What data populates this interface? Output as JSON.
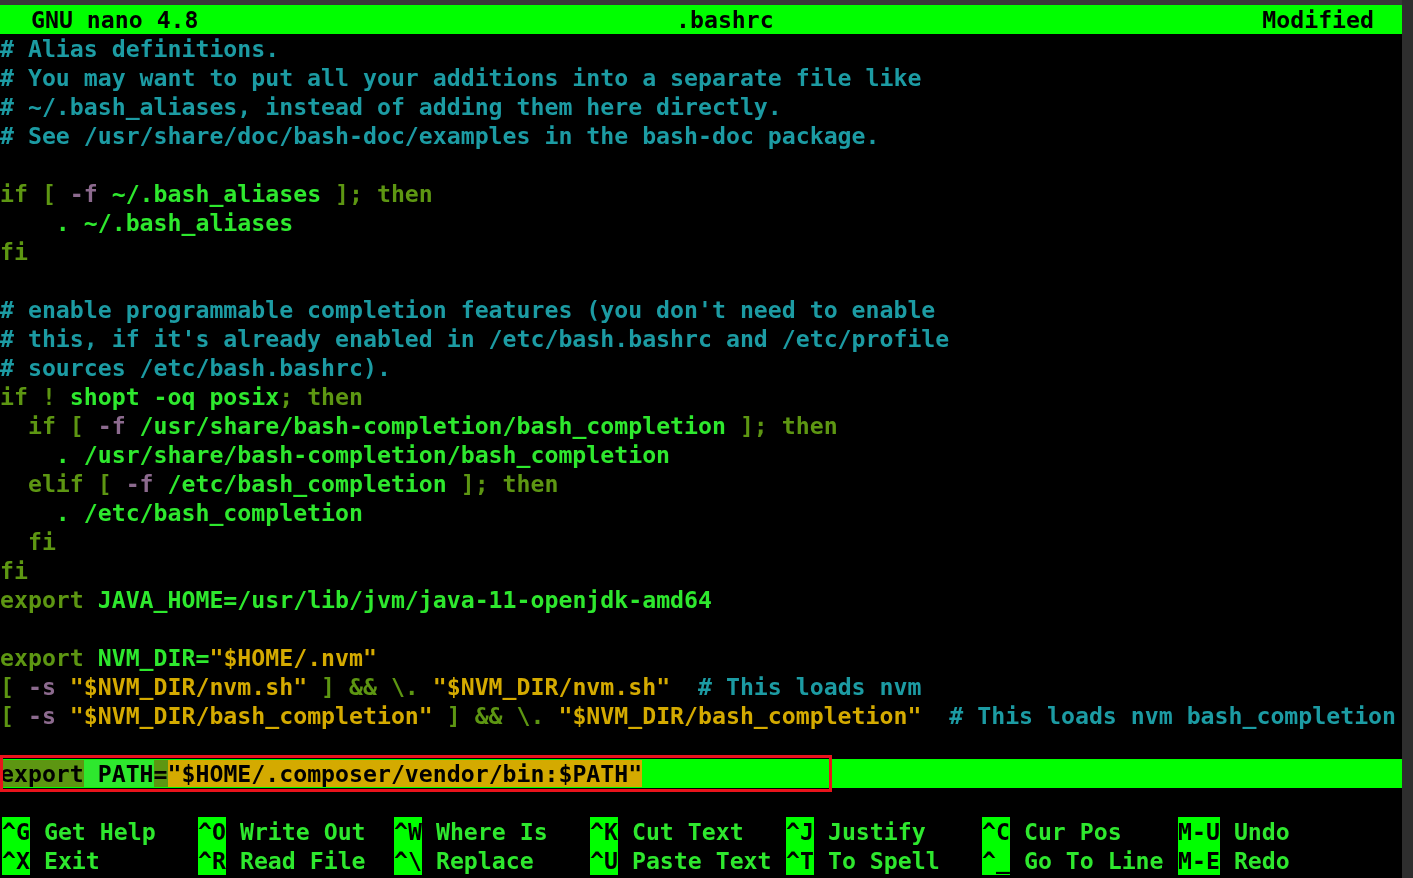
{
  "title_bar": {
    "app": "GNU nano 4.8",
    "file": ".bashrc",
    "status": "Modified"
  },
  "lines": [
    {
      "kind": "code",
      "segments": [
        {
          "kind": "comment",
          "text": "# Alias definitions."
        }
      ]
    },
    {
      "kind": "code",
      "segments": [
        {
          "kind": "comment",
          "text": "# You may want to put all your additions into a separate file like"
        }
      ]
    },
    {
      "kind": "code",
      "segments": [
        {
          "kind": "comment",
          "text": "# ~/.bash_aliases, instead of adding them here directly."
        }
      ]
    },
    {
      "kind": "code",
      "segments": [
        {
          "kind": "comment",
          "text": "# See /usr/share/doc/bash-doc/examples in the bash-doc package."
        }
      ]
    },
    {
      "kind": "blank"
    },
    {
      "kind": "code",
      "segments": [
        {
          "kind": "keyword",
          "text": "if [ "
        },
        {
          "kind": "option",
          "text": "-f"
        },
        {
          "kind": "word",
          "text": " ~/.bash_aliases"
        },
        {
          "kind": "keyword",
          "text": " ]; then"
        }
      ]
    },
    {
      "kind": "code",
      "segments": [
        {
          "kind": "word",
          "text": "    . ~/.bash_aliases"
        }
      ]
    },
    {
      "kind": "code",
      "segments": [
        {
          "kind": "keyword",
          "text": "fi"
        }
      ]
    },
    {
      "kind": "blank"
    },
    {
      "kind": "code",
      "segments": [
        {
          "kind": "comment",
          "text": "# enable programmable completion features (you don't need to enable"
        }
      ]
    },
    {
      "kind": "code",
      "segments": [
        {
          "kind": "comment",
          "text": "# this, if it's already enabled in /etc/bash.bashrc and /etc/profile"
        }
      ]
    },
    {
      "kind": "code",
      "segments": [
        {
          "kind": "comment",
          "text": "# sources /etc/bash.bashrc)."
        }
      ]
    },
    {
      "kind": "code",
      "segments": [
        {
          "kind": "keyword",
          "text": "if ! "
        },
        {
          "kind": "word",
          "text": "shopt -oq posix"
        },
        {
          "kind": "keyword",
          "text": "; then"
        }
      ]
    },
    {
      "kind": "code",
      "segments": [
        {
          "kind": "keyword",
          "text": "  if [ "
        },
        {
          "kind": "option",
          "text": "-f"
        },
        {
          "kind": "word",
          "text": " /usr/share/bash-completion/bash_completion"
        },
        {
          "kind": "keyword",
          "text": " ]; then"
        }
      ]
    },
    {
      "kind": "code",
      "segments": [
        {
          "kind": "word",
          "text": "    . /usr/share/bash-completion/bash_completion"
        }
      ]
    },
    {
      "kind": "code",
      "segments": [
        {
          "kind": "keyword",
          "text": "  elif [ "
        },
        {
          "kind": "option",
          "text": "-f"
        },
        {
          "kind": "word",
          "text": " /etc/bash_completion"
        },
        {
          "kind": "keyword",
          "text": " ]; then"
        }
      ]
    },
    {
      "kind": "code",
      "segments": [
        {
          "kind": "word",
          "text": "    . /etc/bash_completion"
        }
      ]
    },
    {
      "kind": "code",
      "segments": [
        {
          "kind": "keyword",
          "text": "  fi"
        }
      ]
    },
    {
      "kind": "code",
      "segments": [
        {
          "kind": "keyword",
          "text": "fi"
        }
      ]
    },
    {
      "kind": "code",
      "segments": [
        {
          "kind": "keyword",
          "text": "export "
        },
        {
          "kind": "word",
          "text": "JAVA_HOME=/usr/lib/jvm/java-11-openjdk-amd64"
        }
      ]
    },
    {
      "kind": "blank"
    },
    {
      "kind": "code",
      "segments": [
        {
          "kind": "keyword",
          "text": "export "
        },
        {
          "kind": "word",
          "text": "NVM_DIR="
        },
        {
          "kind": "string",
          "text": "\"$HOME/.nvm\""
        }
      ]
    },
    {
      "kind": "code",
      "segments": [
        {
          "kind": "keyword",
          "text": "[ "
        },
        {
          "kind": "option",
          "text": "-s "
        },
        {
          "kind": "string",
          "text": "\"$NVM_DIR/nvm.sh\""
        },
        {
          "kind": "keyword",
          "text": " ] && \\. "
        },
        {
          "kind": "string",
          "text": "\"$NVM_DIR/nvm.sh\""
        },
        {
          "kind": "comment",
          "text": "  # This loads nvm"
        }
      ]
    },
    {
      "kind": "code",
      "segments": [
        {
          "kind": "keyword",
          "text": "[ "
        },
        {
          "kind": "option",
          "text": "-s "
        },
        {
          "kind": "string",
          "text": "\"$NVM_DIR/bash_completion\""
        },
        {
          "kind": "keyword",
          "text": " ] && \\. "
        },
        {
          "kind": "string",
          "text": "\"$NVM_DIR/bash_completion\""
        },
        {
          "kind": "comment",
          "text": "  # This loads nvm bash_completion"
        }
      ]
    },
    {
      "kind": "blank"
    },
    {
      "kind": "marked",
      "segments": [
        {
          "kind": "keyword",
          "text": "export"
        },
        {
          "kind": "word",
          "text": " PATH"
        },
        {
          "kind": "keyword",
          "text": "="
        },
        {
          "kind": "string",
          "text": "\"$HOME/.composer/vendor/bin:$PATH\""
        }
      ]
    }
  ],
  "shortcuts": [
    {
      "items": [
        {
          "key": "^G",
          "label": "Get Help"
        },
        {
          "key": "^O",
          "label": "Write Out"
        },
        {
          "key": "^W",
          "label": "Where Is"
        },
        {
          "key": "^K",
          "label": "Cut Text"
        },
        {
          "key": "^J",
          "label": "Justify"
        },
        {
          "key": "^C",
          "label": "Cur Pos"
        },
        {
          "key": "M-U",
          "label": "Undo"
        }
      ]
    },
    {
      "items": [
        {
          "key": "^X",
          "label": "Exit"
        },
        {
          "key": "^R",
          "label": "Read File"
        },
        {
          "key": "^\\",
          "label": "Replace"
        },
        {
          "key": "^U",
          "label": "Paste Text"
        },
        {
          "key": "^T",
          "label": "To Spell"
        },
        {
          "key": "^_",
          "label": "Go To Line"
        },
        {
          "key": "M-E",
          "label": "Redo"
        }
      ]
    }
  ]
}
